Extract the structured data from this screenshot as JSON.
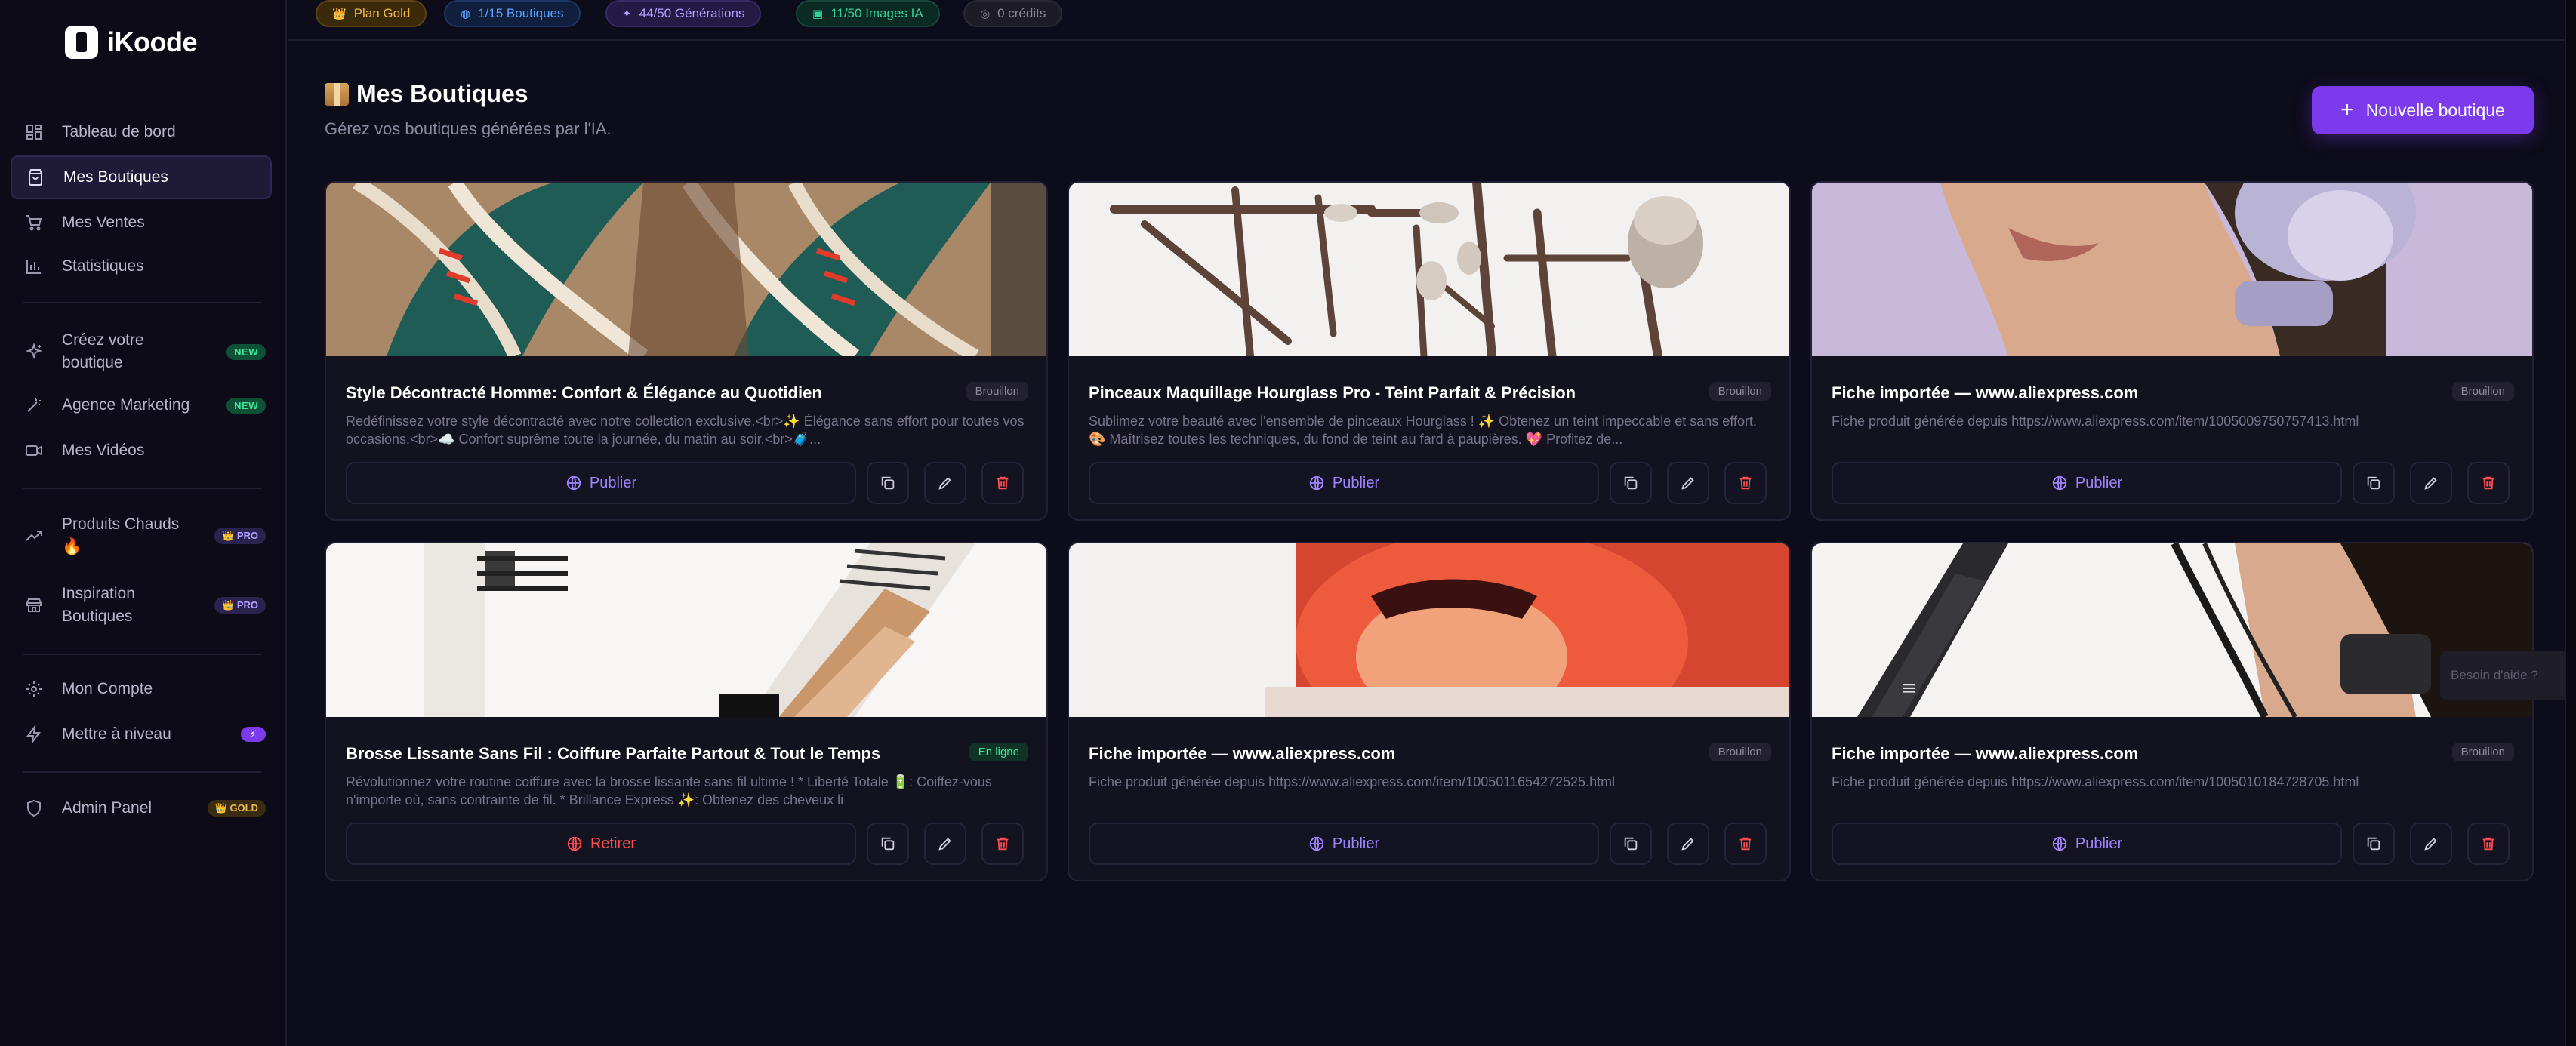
{
  "app": {
    "name": "iKoode"
  },
  "sidebar": {
    "items": [
      {
        "label": "Tableau de bord",
        "icon": "dashboard-icon"
      },
      {
        "label": "Mes Boutiques",
        "icon": "store-icon"
      },
      {
        "label": "Mes Ventes",
        "icon": "cart-icon"
      },
      {
        "label": "Statistiques",
        "icon": "chart-icon"
      },
      {
        "label": "Créez votre boutique",
        "icon": "sparkles-icon",
        "badge": "NEW"
      },
      {
        "label": "Agence Marketing",
        "icon": "wand-icon",
        "badge": "NEW"
      },
      {
        "label": "Mes Vidéos",
        "icon": "video-icon"
      },
      {
        "label": "Produits Chauds 🔥",
        "icon": "trending-icon",
        "badge": "👑 PRO"
      },
      {
        "label": "Inspiration Boutiques",
        "icon": "shop-icon",
        "badge": "👑 PRO"
      },
      {
        "label": "Mon Compte",
        "icon": "settings-icon"
      },
      {
        "label": "Mettre à niveau",
        "icon": "bolt-icon",
        "badge": "⚡"
      },
      {
        "label": "Admin Panel",
        "icon": "shield-icon",
        "badge": "👑 GOLD"
      }
    ]
  },
  "topbar": {
    "chips": [
      {
        "label": "Plan Gold",
        "icon": "👑"
      },
      {
        "label": "1/15 Boutiques",
        "icon": "◍"
      },
      {
        "label": "44/50 Générations",
        "icon": "✦"
      },
      {
        "label": "11/50 Images IA",
        "icon": "▣"
      },
      {
        "label": "0 crédits",
        "icon": "◎"
      }
    ]
  },
  "header": {
    "title": "Mes Boutiques",
    "subtitle": "Gérez vos boutiques générées par l'IA.",
    "new_button": "Nouvelle boutique"
  },
  "cards": [
    {
      "title": "Style Décontracté Homme: Confort & Élégance au Quotidien",
      "status": "Brouillon",
      "desc": "Redéfinissez votre style décontracté avec notre collection exclusive.<br>✨ Élégance sans effort pour toutes vos occasions.<br>☁️ Confort suprême toute la journée, du matin au soir.<br>🧳...",
      "action": "Publier"
    },
    {
      "title": "Pinceaux Maquillage Hourglass Pro - Teint Parfait & Précision",
      "status": "Brouillon",
      "desc": "Sublimez votre beauté avec l'ensemble de pinceaux Hourglass ! ✨ Obtenez un teint impeccable et sans effort. 🎨 Maîtrisez toutes les techniques, du fond de teint au fard à paupières. 💖 Profitez de...",
      "action": "Publier"
    },
    {
      "title": "Fiche importée — www.aliexpress.com",
      "status": "Brouillon",
      "desc": "Fiche produit générée depuis https://www.aliexpress.com/item/1005009750757413.html",
      "action": "Publier"
    },
    {
      "title": "Brosse Lissante Sans Fil : Coiffure Parfaite Partout & Tout le Temps",
      "status": "En ligne",
      "desc": "Révolutionnez votre routine coiffure avec la brosse lissante sans fil ultime ! * Liberté Totale 🔋: Coiffez-vous n'importe où, sans contrainte de fil. * Brillance Express ✨: Obtenez des cheveux li",
      "action": "Retirer"
    },
    {
      "title": "Fiche importée — www.aliexpress.com",
      "status": "Brouillon",
      "desc": "Fiche produit générée depuis https://www.aliexpress.com/item/1005011654272525.html",
      "action": "Publier"
    },
    {
      "title": "Fiche importée — www.aliexpress.com",
      "status": "Brouillon",
      "desc": "Fiche produit générée depuis https://www.aliexpress.com/item/1005010184728705.html",
      "action": "Publier"
    }
  ],
  "help": {
    "label": "Besoin d'aide ?"
  },
  "colors": {
    "accent": "#7c3aed",
    "danger": "#ff4d4d",
    "online": "#3ee59a",
    "background": "#0d0c1a"
  }
}
